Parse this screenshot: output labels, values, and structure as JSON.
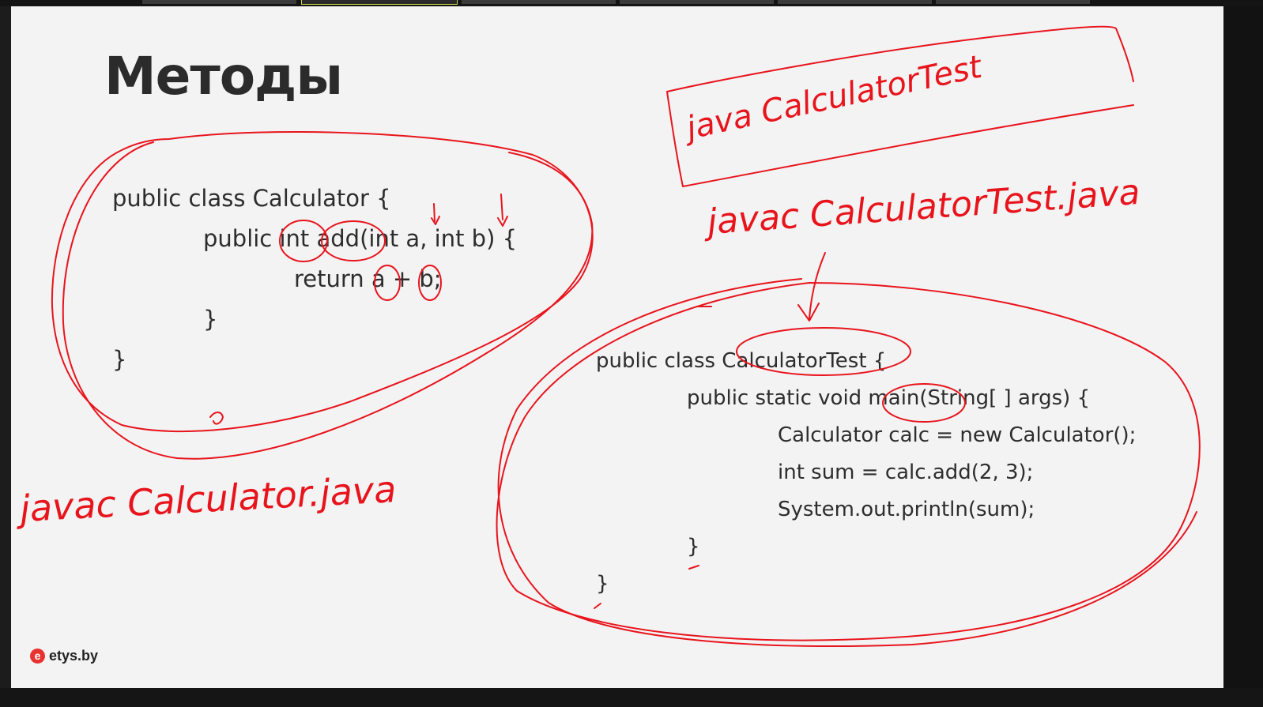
{
  "slide": {
    "title": "Методы",
    "code_left": [
      "public class Calculator {",
      "public int add(int a, int b) {",
      "return a + b;",
      "}",
      "}"
    ],
    "code_right": [
      "public class CalculatorTest {",
      "public static void main(String[ ] args) {",
      "Calculator calc = new Calculator();",
      "int sum = calc.add(2, 3);",
      "System.out.println(sum);",
      "}",
      "}"
    ],
    "logo_mark": "e",
    "logo_text": "etys.by"
  },
  "annotations": {
    "ink_color": "#e8141c",
    "handwritten_1": "java CalculatorTest",
    "handwritten_2": "javac CalculatorTest.java",
    "handwritten_3": "javac Calculator.java"
  }
}
